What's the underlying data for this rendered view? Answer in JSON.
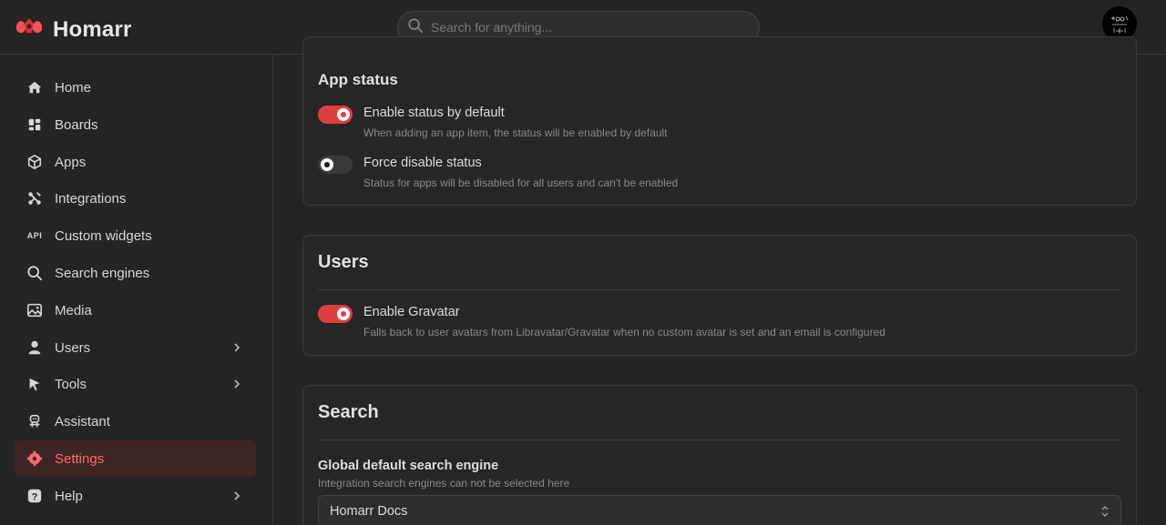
{
  "header": {
    "brand": "Homarr",
    "search_placeholder": "Search for anything..."
  },
  "sidebar": {
    "items": [
      {
        "label": "Home",
        "icon": "home-icon"
      },
      {
        "label": "Boards",
        "icon": "boards-icon"
      },
      {
        "label": "Apps",
        "icon": "box-icon"
      },
      {
        "label": "Integrations",
        "icon": "plug-icon"
      },
      {
        "label": "Custom widgets",
        "icon": "api-icon",
        "icon_text": "API"
      },
      {
        "label": "Search engines",
        "icon": "search-icon"
      },
      {
        "label": "Media",
        "icon": "image-icon"
      },
      {
        "label": "Users",
        "icon": "user-icon"
      },
      {
        "label": "Tools",
        "icon": "pointer-icon"
      },
      {
        "label": "Assistant",
        "icon": "robot-icon"
      },
      {
        "label": "Settings",
        "icon": "gear-icon",
        "active": true
      },
      {
        "label": "Help",
        "icon": "question-icon"
      }
    ]
  },
  "app_status": {
    "title": "App status",
    "enable_status": {
      "label": "Enable status by default",
      "description": "When adding an app item, the status will be enabled by default",
      "checked": true
    },
    "force_disable": {
      "label": "Force disable status",
      "description": "Status for apps will be disabled for all users and can't be enabled",
      "checked": false
    }
  },
  "users": {
    "title": "Users",
    "gravatar": {
      "label": "Enable Gravatar",
      "description": "Falls back to user avatars from Libravatar/Gravatar when no custom avatar is set and an email is configured",
      "checked": true
    }
  },
  "search": {
    "title": "Search",
    "engine_label": "Global default search engine",
    "engine_desc": "Integration search engines can not be selected here",
    "engine_value": "Homarr Docs"
  },
  "colors": {
    "accent": "#e03e3e",
    "active_bg": "#3d2425",
    "active_text": "#ff6b6b"
  }
}
